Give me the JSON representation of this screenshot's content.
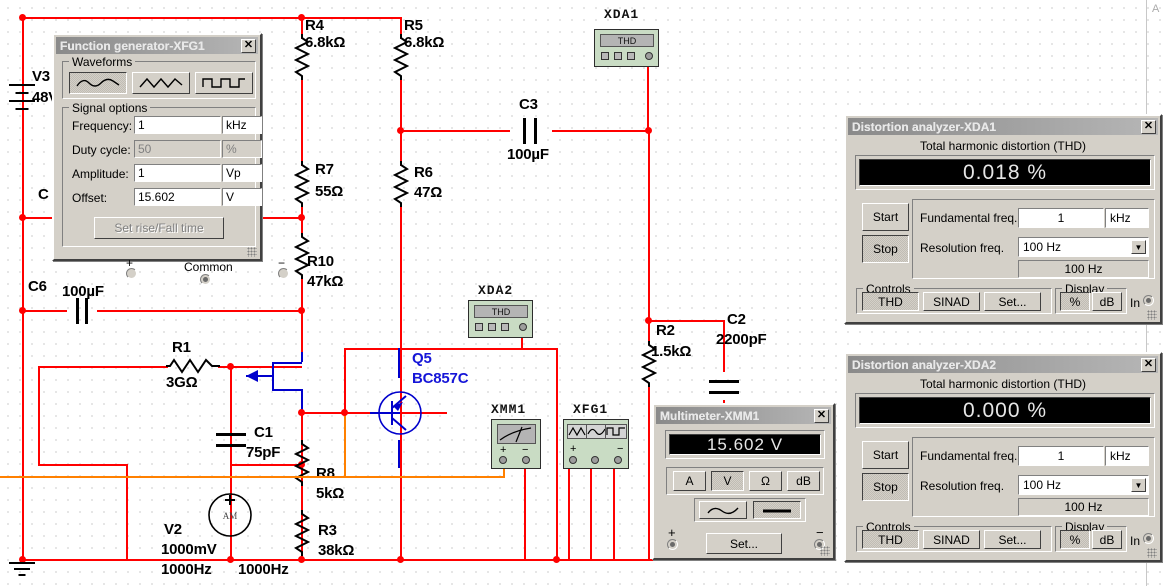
{
  "schematic": {
    "components": [
      {
        "ref": "V3",
        "value": "48V",
        "type": "battery"
      },
      {
        "ref": "C6",
        "value": "100µF",
        "type": "capacitor"
      },
      {
        "ref": "R4",
        "value": "6.8kΩ",
        "type": "resistor"
      },
      {
        "ref": "R5",
        "value": "6.8kΩ",
        "type": "resistor"
      },
      {
        "ref": "R7",
        "value": "55Ω",
        "type": "resistor"
      },
      {
        "ref": "R6",
        "value": "47Ω",
        "type": "resistor"
      },
      {
        "ref": "R10",
        "value": "47kΩ",
        "type": "resistor"
      },
      {
        "ref": "C3",
        "value": "100µF",
        "type": "capacitor"
      },
      {
        "ref": "R2",
        "value": "1.5kΩ",
        "type": "resistor"
      },
      {
        "ref": "C2",
        "value": "2200pF",
        "type": "capacitor"
      },
      {
        "ref": "R1",
        "value": "3GΩ",
        "type": "resistor"
      },
      {
        "ref": "C1",
        "value": "75pF",
        "type": "capacitor"
      },
      {
        "ref": "R8",
        "value": "5kΩ",
        "type": "resistor"
      },
      {
        "ref": "R3",
        "value": "38kΩ",
        "type": "resistor"
      },
      {
        "ref": "Q5",
        "value": "BC857C",
        "type": "transistor"
      },
      {
        "ref": "V2",
        "value": "1000mV",
        "value2": "1000Hz",
        "value3": "1000Hz",
        "type": "ac-source",
        "symbol": "AM"
      }
    ],
    "instrument_icons": [
      {
        "ref": "XDA1",
        "screen": "THD"
      },
      {
        "ref": "XDA2",
        "screen": "THD"
      },
      {
        "ref": "XMM1",
        "screen": "meter",
        "plus": "+",
        "minus": "−"
      },
      {
        "ref": "XFG1",
        "screen": "waveforms",
        "plus": "+",
        "minus": "−"
      }
    ],
    "partial_labels": {
      "c_label": "C",
      "corner_letter": "A"
    },
    "colors": {
      "wire": "#ff0000",
      "wire_blue": "#0000cc",
      "wire_orange": "#ff8000",
      "device_blue": "#1515d8"
    }
  },
  "function_generator": {
    "title": "Function generator-XFG1",
    "close_label": "✕",
    "waveforms_group": "Waveforms",
    "waveform_options": [
      "sine",
      "triangle",
      "square"
    ],
    "selected_waveform": "sine",
    "signal_options_group": "Signal options",
    "rows": [
      {
        "label": "Frequency:",
        "value": "1",
        "unit": "kHz",
        "disabled": false
      },
      {
        "label": "Duty cycle:",
        "value": "50",
        "unit": "%",
        "disabled": true
      },
      {
        "label": "Amplitude:",
        "value": "1",
        "unit": "Vp",
        "disabled": false
      },
      {
        "label": "Offset:",
        "value": "15.602",
        "unit": "V",
        "disabled": false
      }
    ],
    "rise_fall_button": "Set rise/Fall time",
    "terminals": {
      "plus": "+",
      "common": "Common",
      "minus": "−"
    }
  },
  "multimeter": {
    "title": "Multimeter-XMM1",
    "close_label": "✕",
    "display": "15.602 V",
    "mode_buttons": [
      "A",
      "V",
      "Ω",
      "dB"
    ],
    "selected_mode": "V",
    "signal_buttons": [
      "ac-sine",
      "dc-line"
    ],
    "selected_signal": "dc-line",
    "set_button": "Set...",
    "terminals": {
      "plus": "+",
      "minus": "−"
    }
  },
  "distortion_analyzers": [
    {
      "title": "Distortion analyzer-XDA1",
      "close_label": "✕",
      "readout_label": "Total harmonic distortion (THD)",
      "display": "0.018 %",
      "start_button": "Start",
      "stop_button": "Stop",
      "fundamental_label": "Fundamental freq.",
      "fundamental_value": "1",
      "fundamental_unit": "kHz",
      "resolution_label": "Resolution freq.",
      "resolution_value": "100 Hz",
      "resolution_readout": "100 Hz",
      "controls_group": "Controls",
      "controls": [
        "THD",
        "SINAD",
        "Set..."
      ],
      "selected_control": "THD",
      "display_group": "Display",
      "display_units": [
        "%",
        "dB"
      ],
      "selected_unit": "%",
      "in_label": "In"
    },
    {
      "title": "Distortion analyzer-XDA2",
      "close_label": "✕",
      "readout_label": "Total harmonic distortion (THD)",
      "display": "0.000 %",
      "start_button": "Start",
      "stop_button": "Stop",
      "fundamental_label": "Fundamental freq.",
      "fundamental_value": "1",
      "fundamental_unit": "kHz",
      "resolution_label": "Resolution freq.",
      "resolution_value": "100 Hz",
      "resolution_readout": "100 Hz",
      "controls_group": "Controls",
      "controls": [
        "THD",
        "SINAD",
        "Set..."
      ],
      "selected_control": "THD",
      "display_group": "Display",
      "display_units": [
        "%",
        "dB"
      ],
      "selected_unit": "%",
      "in_label": "In"
    }
  ]
}
